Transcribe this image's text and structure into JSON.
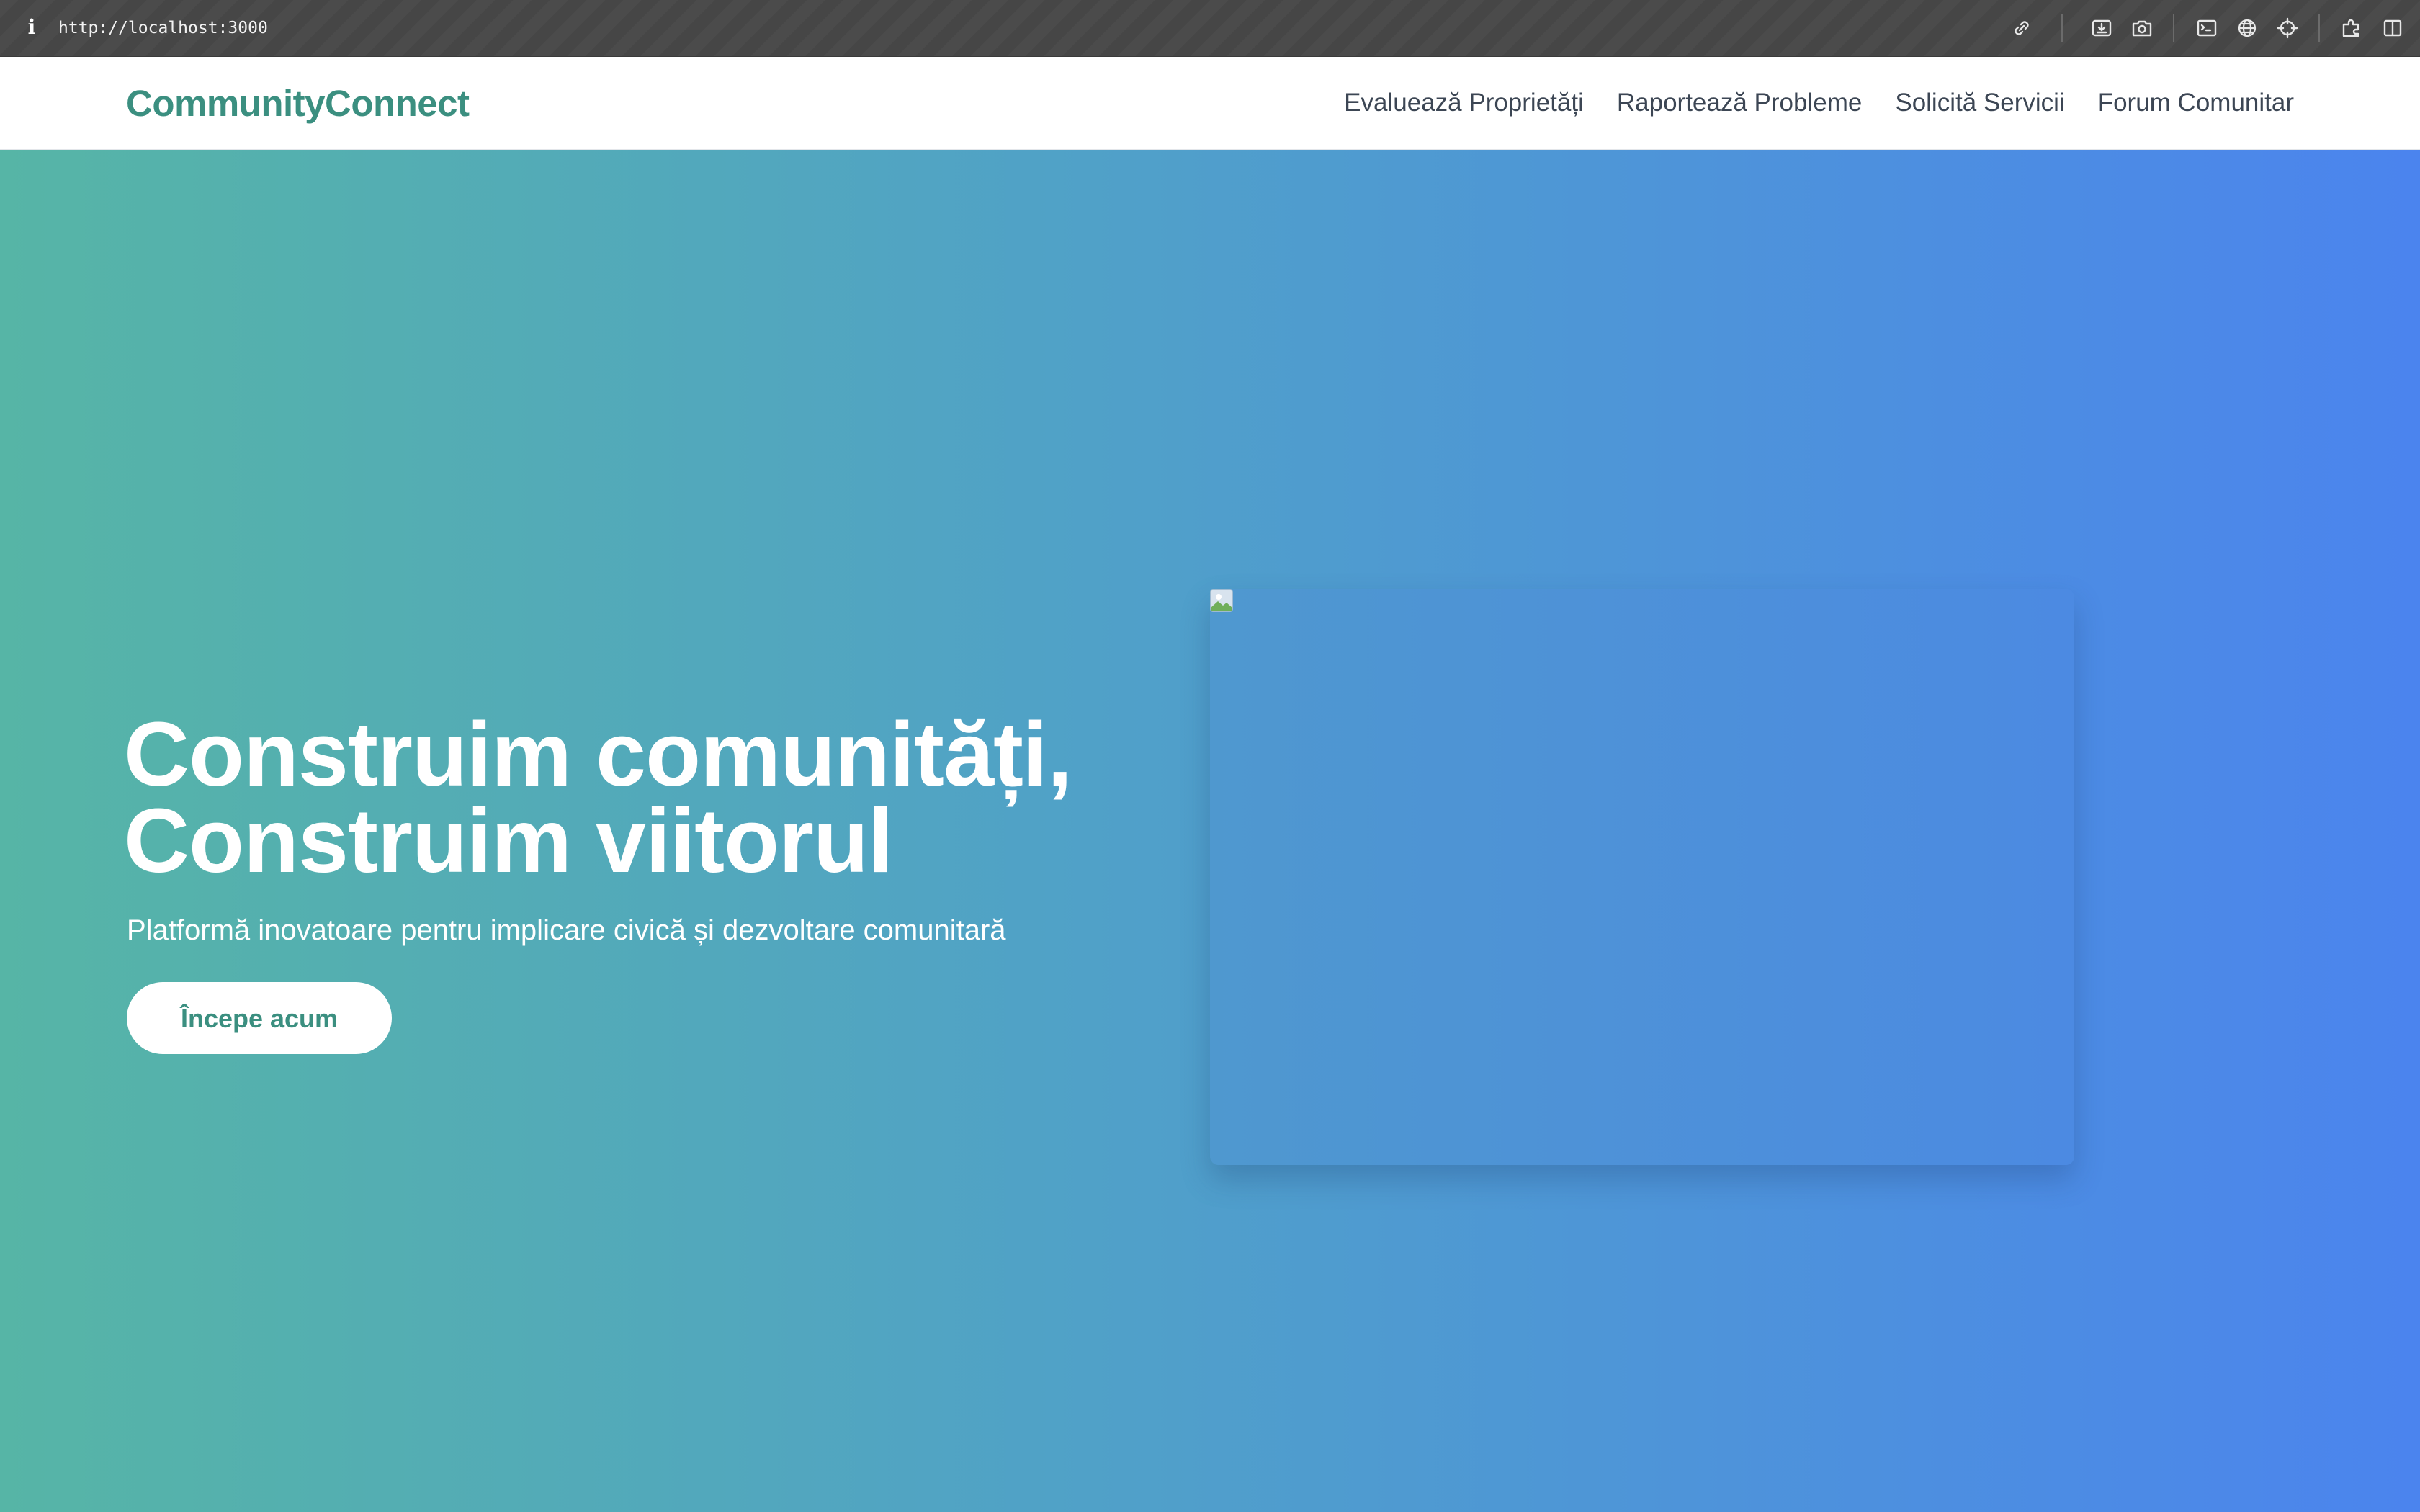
{
  "browser": {
    "url": "http://localhost:3000",
    "info_glyph": "i",
    "toolbar_icons": [
      "link-icon",
      "download-icon",
      "camera-icon",
      "terminal-icon",
      "globe-icon",
      "crosshair-icon",
      "extensions-icon",
      "sidebar-icon"
    ]
  },
  "header": {
    "logo": "CommunityConnect",
    "nav": [
      "Evaluează Proprietăți",
      "Raportează Probleme",
      "Solicită Servicii",
      "Forum Comunitar"
    ]
  },
  "hero": {
    "title_line1": "Construim comunități,",
    "title_line2": "Construim viitorul",
    "subtitle": "Platformă inovatoare pentru implicare civică și dezvoltare comunitară",
    "cta_label": "Începe acum",
    "image_icon": "broken-image-icon"
  },
  "colors": {
    "brand": "#3b8f80",
    "gradient_start": "#56b5a6",
    "gradient_end": "#4b84ee",
    "nav_text": "#3c4654"
  }
}
